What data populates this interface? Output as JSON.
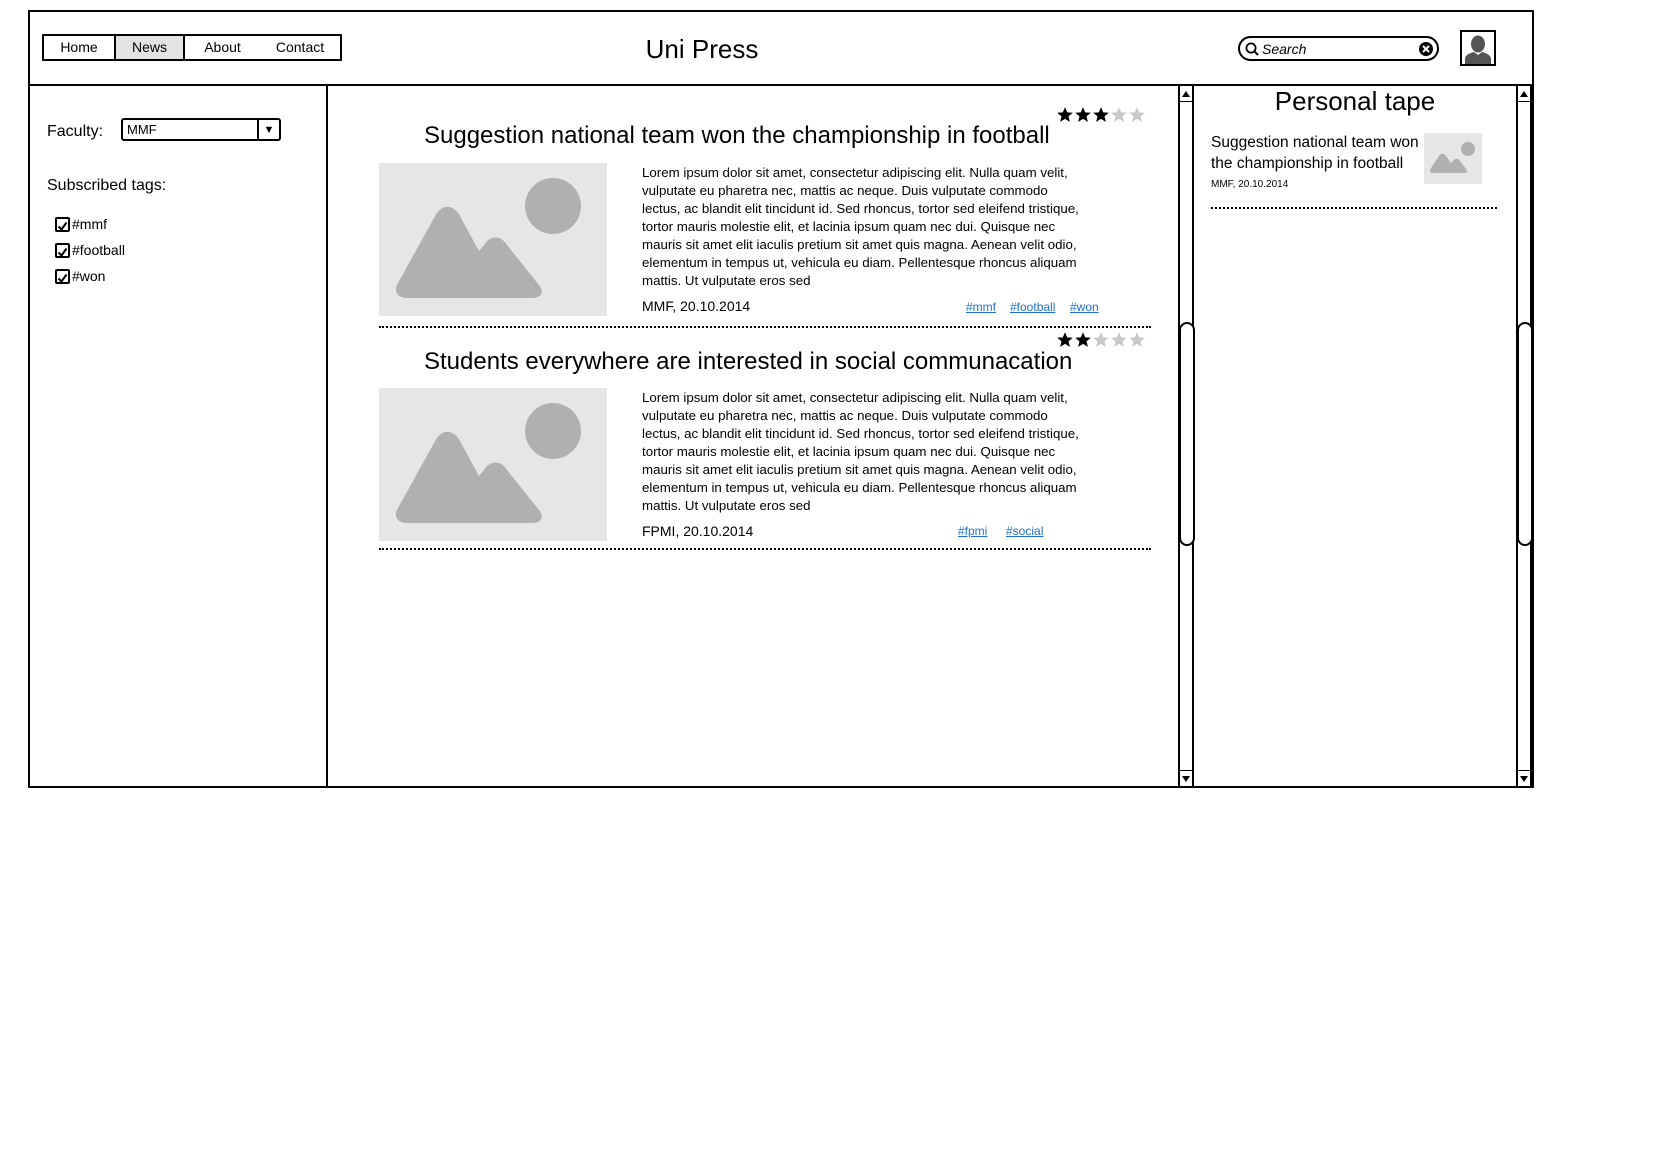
{
  "header": {
    "nav": [
      {
        "label": "Home",
        "selected": false
      },
      {
        "label": "News",
        "selected": true
      },
      {
        "label": "About",
        "selected": false
      },
      {
        "label": "Contact",
        "selected": false
      }
    ],
    "title": "Uni Press",
    "search_placeholder": "Search"
  },
  "sidebar": {
    "faculty_label": "Faculty:",
    "faculty_value": "MMF",
    "subscribed_label": "Subscribed tags:",
    "tags": [
      {
        "label": "#mmf",
        "checked": true
      },
      {
        "label": "#football",
        "checked": true
      },
      {
        "label": "#won",
        "checked": true
      }
    ]
  },
  "articles": [
    {
      "title": "Suggestion national team won the championship in football",
      "rating": 3,
      "max_rating": 5,
      "body": "Lorem ipsum dolor sit amet, consectetur adipiscing elit. Nulla quam velit, vulputate eu pharetra nec, mattis ac neque. Duis vulputate commodo lectus, ac blandit elit tincidunt id. Sed rhoncus, tortor sed eleifend tristique, tortor mauris molestie elit, et lacinia ipsum quam nec dui. Quisque nec mauris sit amet elit iaculis pretium sit amet quis magna. Aenean velit odio, elementum in tempus ut, vehicula eu diam. Pellentesque rhoncus aliquam mattis. Ut vulputate eros sed",
      "meta": "MMF, 20.10.2014",
      "tags": [
        "#mmf",
        "#football",
        "#won"
      ]
    },
    {
      "title": "Students everywhere are interested in social communacation",
      "rating": 2,
      "max_rating": 5,
      "body": "Lorem ipsum dolor sit amet, consectetur adipiscing elit. Nulla quam velit, vulputate eu pharetra nec, mattis ac neque. Duis vulputate commodo lectus, ac blandit elit tincidunt id. Sed rhoncus, tortor sed eleifend tristique, tortor mauris molestie elit, et lacinia ipsum quam nec dui. Quisque nec mauris sit amet elit iaculis pretium sit amet quis magna. Aenean velit odio, elementum in tempus ut, vehicula eu diam. Pellentesque rhoncus aliquam mattis. Ut vulputate eros sed",
      "meta": "FPMI, 20.10.2014",
      "tags": [
        "#fpmi",
        "#social"
      ]
    }
  ],
  "personal_tape": {
    "title": "Personal tape",
    "items": [
      {
        "text": "Suggestion national team won the championship in football",
        "meta": "MMF, 20.10.2014"
      }
    ]
  },
  "colors": {
    "link": "#1f6fd1",
    "placeholder_bg": "#e6e6e6",
    "placeholder_shape": "#b0b0b0",
    "star_on": "#000000",
    "star_off": "#c8c8c8"
  }
}
